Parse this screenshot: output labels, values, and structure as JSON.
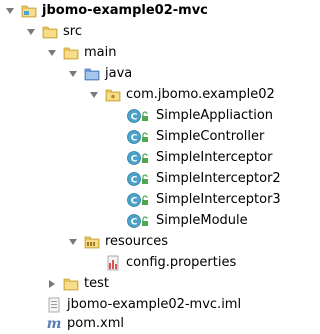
{
  "tree": {
    "root": {
      "label": "jbomo-example02-mvc",
      "icon": "module-folder-icon",
      "expanded": true
    },
    "src": {
      "label": "src",
      "icon": "folder-icon",
      "expanded": true
    },
    "main": {
      "label": "main",
      "icon": "folder-icon",
      "expanded": true
    },
    "java": {
      "label": "java",
      "icon": "source-folder-icon",
      "expanded": true
    },
    "package": {
      "label": "com.jbomo.example02",
      "icon": "package-icon",
      "expanded": true
    },
    "classes": [
      {
        "label": "SimpleAppliaction",
        "icon": "java-class-icon"
      },
      {
        "label": "SimpleController",
        "icon": "java-class-icon"
      },
      {
        "label": "SimpleInterceptor",
        "icon": "java-class-icon"
      },
      {
        "label": "SimpleInterceptor2",
        "icon": "java-class-icon"
      },
      {
        "label": "SimpleInterceptor3",
        "icon": "java-class-icon"
      },
      {
        "label": "SimpleModule",
        "icon": "java-class-icon"
      }
    ],
    "resources": {
      "label": "resources",
      "icon": "resources-folder-icon",
      "expanded": true
    },
    "config": {
      "label": "config.properties",
      "icon": "properties-file-icon"
    },
    "test": {
      "label": "test",
      "icon": "folder-icon",
      "expanded": false
    },
    "iml": {
      "label": "jbomo-example02-mvc.iml",
      "icon": "iml-file-icon"
    },
    "pom": {
      "label": "pom.xml",
      "icon": "maven-icon",
      "glyph": "m"
    }
  },
  "colors": {
    "folder": "#e8c25a",
    "folder_dark": "#c9a13a",
    "source_blue": "#6d9ad6",
    "class_circle": "#4ba3c9",
    "lock_green": "#4fa84f",
    "arrow": "#7a7a7a"
  }
}
